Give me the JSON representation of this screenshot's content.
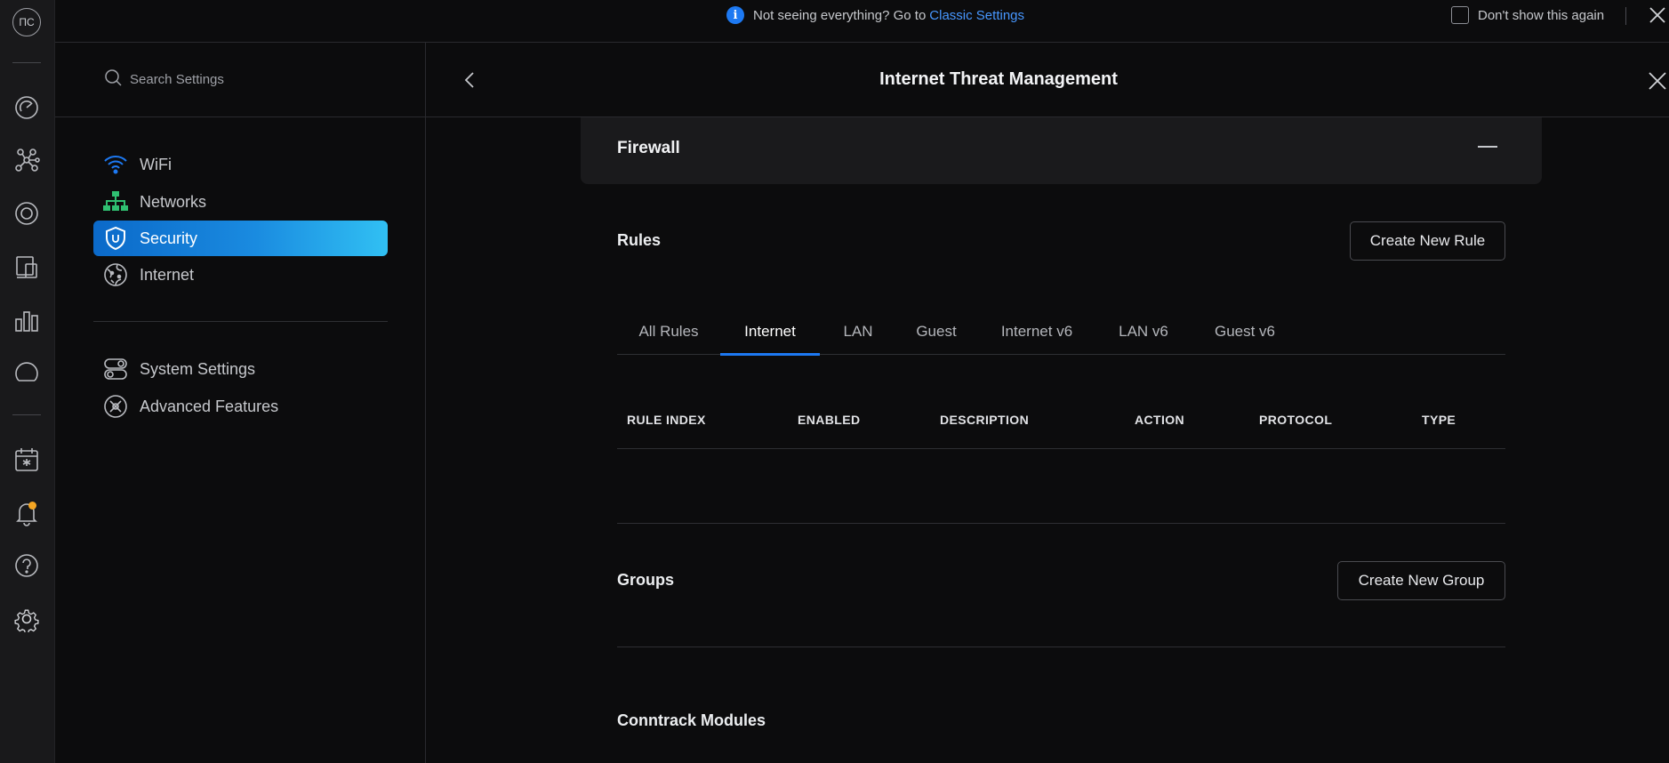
{
  "rail": {
    "avatar_initials": "ПС",
    "items": [
      {
        "name": "dashboard-icon"
      },
      {
        "name": "topology-icon"
      },
      {
        "name": "devices-icon"
      },
      {
        "name": "clients-icon"
      },
      {
        "name": "statistics-icon"
      },
      {
        "name": "insights-icon"
      },
      {
        "name": "events-calendar-icon"
      },
      {
        "name": "notifications-bell-icon"
      },
      {
        "name": "help-icon"
      },
      {
        "name": "settings-gear-icon"
      }
    ],
    "notification_dot_color": "#f5a623"
  },
  "banner": {
    "message": "Not seeing everything? Go to",
    "link_text": "Classic Settings",
    "checkbox_label": "Don't show this again"
  },
  "nav": {
    "search_placeholder": "Search Settings",
    "items": [
      {
        "label": "WiFi",
        "icon": "wifi-icon"
      },
      {
        "label": "Networks",
        "icon": "networks-icon"
      },
      {
        "label": "Security",
        "icon": "shield-icon",
        "active": true
      },
      {
        "label": "Internet",
        "icon": "globe-icon"
      },
      {
        "label": "System Settings",
        "icon": "toggles-icon"
      },
      {
        "label": "Advanced Features",
        "icon": "advanced-tools-icon"
      }
    ]
  },
  "header": {
    "title": "Internet Threat Management"
  },
  "firewall": {
    "title": "Firewall",
    "rules_label": "Rules",
    "create_rule_label": "Create New Rule",
    "tabs": [
      "All Rules",
      "Internet",
      "LAN",
      "Guest",
      "Internet v6",
      "LAN v6",
      "Guest v6"
    ],
    "active_tab": "Internet",
    "columns": [
      "RULE INDEX",
      "ENABLED",
      "DESCRIPTION",
      "ACTION",
      "PROTOCOL",
      "TYPE"
    ],
    "groups_label": "Groups",
    "create_group_label": "Create New Group",
    "conntrack_label": "Conntrack Modules"
  },
  "colors": {
    "accent": "#1d79f2",
    "active_gradient_start": "#0b69c9",
    "active_gradient_end": "#31c0f3"
  }
}
